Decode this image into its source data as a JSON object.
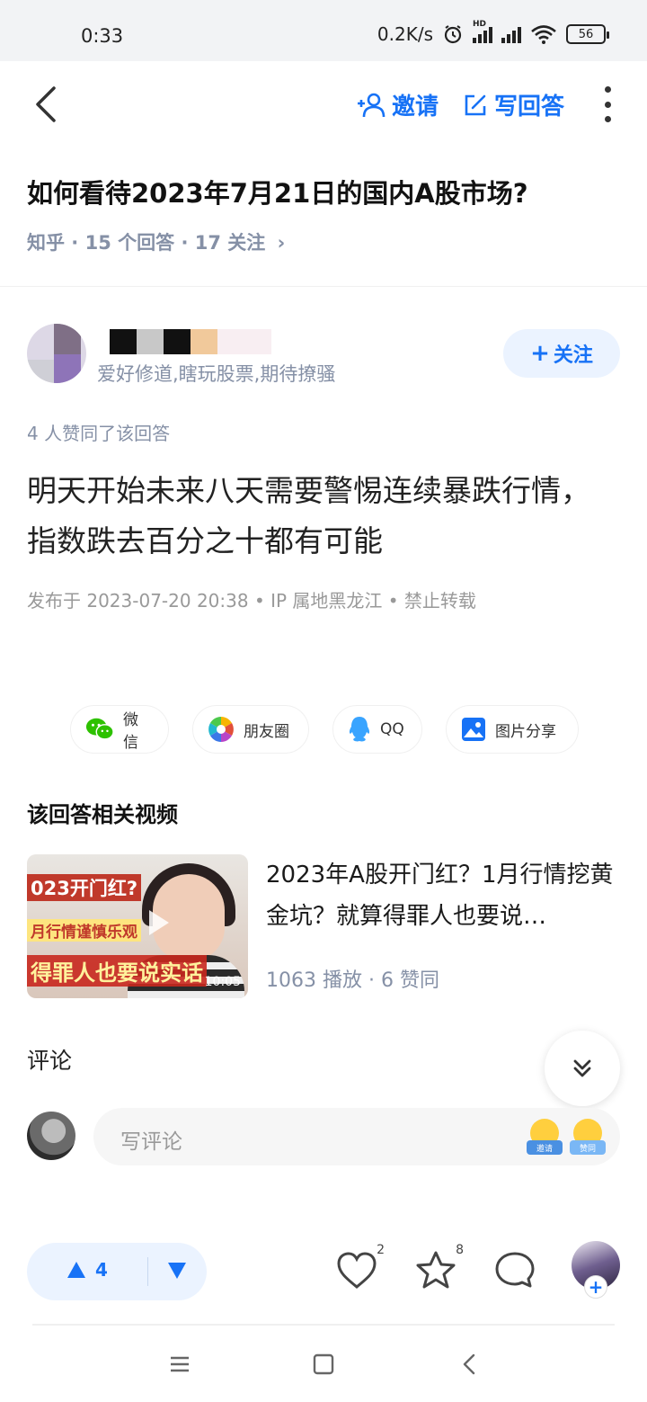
{
  "status_bar": {
    "time": "0:33",
    "net_speed": "0.2K/s",
    "hd": "HD",
    "battery": "56"
  },
  "nav": {
    "invite_label": "邀请",
    "write_answer_label": "写回答"
  },
  "question": {
    "title": "如何看待2023年7月21日的国内A股市场?",
    "meta": "知乎 · 15 个回答 · 17 关注",
    "meta_chevron": "›"
  },
  "author": {
    "bio": "爱好修道,瞎玩股票,期待撩骚",
    "follow_label": "关注",
    "follow_plus": "+"
  },
  "answer": {
    "votes_line": "4 人赞同了该回答",
    "content": "明天开始未来八天需要警惕连续暴跌行情，指数跌去百分之十都有可能",
    "publish_info": "发布于 2023-07-20 20:38 • IP 属地黑龙江 • 禁止转载"
  },
  "share": {
    "items": [
      {
        "label": "微信",
        "icon": "wechat-icon"
      },
      {
        "label": "朋友圈",
        "icon": "moments-icon"
      },
      {
        "label": "QQ",
        "icon": "qq-icon"
      },
      {
        "label": "图片分享",
        "icon": "image-share-icon"
      }
    ]
  },
  "related": {
    "heading": "该回答相关视频",
    "video": {
      "title": "2023年A股开门红？1月行情挖黄金坑？就算得罪人也要说…",
      "stats": "1063 播放 · 6 赞同",
      "duration": "10:05",
      "thumb_caption_1": "023开门红?",
      "thumb_caption_2": "月行情谨慎乐观",
      "thumb_caption_3": "得罪人也要说实话"
    }
  },
  "comments": {
    "label": "评论",
    "placeholder": "写评论",
    "emoji_1": "邀请",
    "emoji_2": "赞同"
  },
  "action_bar": {
    "upvotes": "4",
    "like_count": "2",
    "favorite_count": "8"
  },
  "colors": {
    "accent": "#1772f6",
    "accent_light": "#ebf3ff",
    "meta_gray": "#8590a6"
  }
}
